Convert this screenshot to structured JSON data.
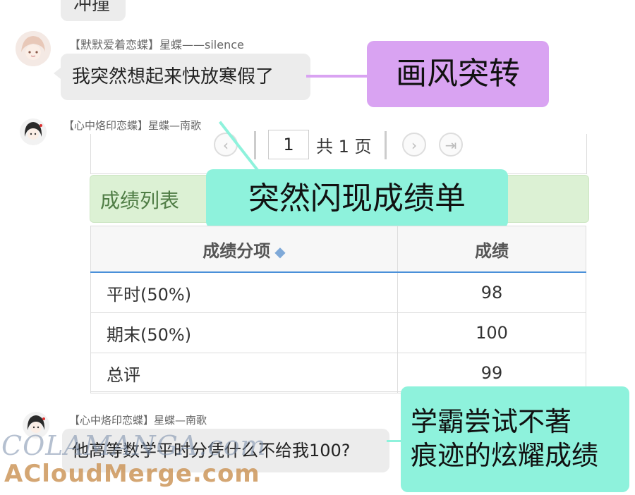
{
  "top_bubble": {
    "text": "冲撞"
  },
  "chat": [
    {
      "username": "【默默爱着恋蝶】星蝶——silence",
      "message": "我突然想起来快放寒假了"
    },
    {
      "username": "【心中烙印恋蝶】星蝶—南歌"
    },
    {
      "username": "【心中烙印恋蝶】星蝶—南歌",
      "message": "他高等数学平时分凭什么不给我100?"
    }
  ],
  "captions": [
    {
      "text": "画风突转",
      "color": "#d9a3f2"
    },
    {
      "text": "突然闪现成绩单",
      "color": "#8ef2dc"
    },
    {
      "line1": "学霸尝试不著",
      "line2": "痕迹的炫耀成绩",
      "color": "#8ef2dc"
    }
  ],
  "grade_panel": {
    "pager": {
      "prev_icon": "chevron-left-icon",
      "current_page": "1",
      "total_label": "共 1 页",
      "next_icon": "chevron-right-icon",
      "last_icon": "last-page-icon"
    },
    "section_title": "成绩列表",
    "columns": [
      "成绩分项",
      "成绩"
    ],
    "sort_icon": "sort-icon",
    "rows": [
      {
        "name": "平时(50%)",
        "score": "98"
      },
      {
        "name": "期末(50%)",
        "score": "100"
      },
      {
        "name": "总评",
        "score": "99"
      }
    ]
  },
  "watermarks": {
    "line1": "COLAMANGA.com",
    "line2": "ACloudMerge.com"
  }
}
